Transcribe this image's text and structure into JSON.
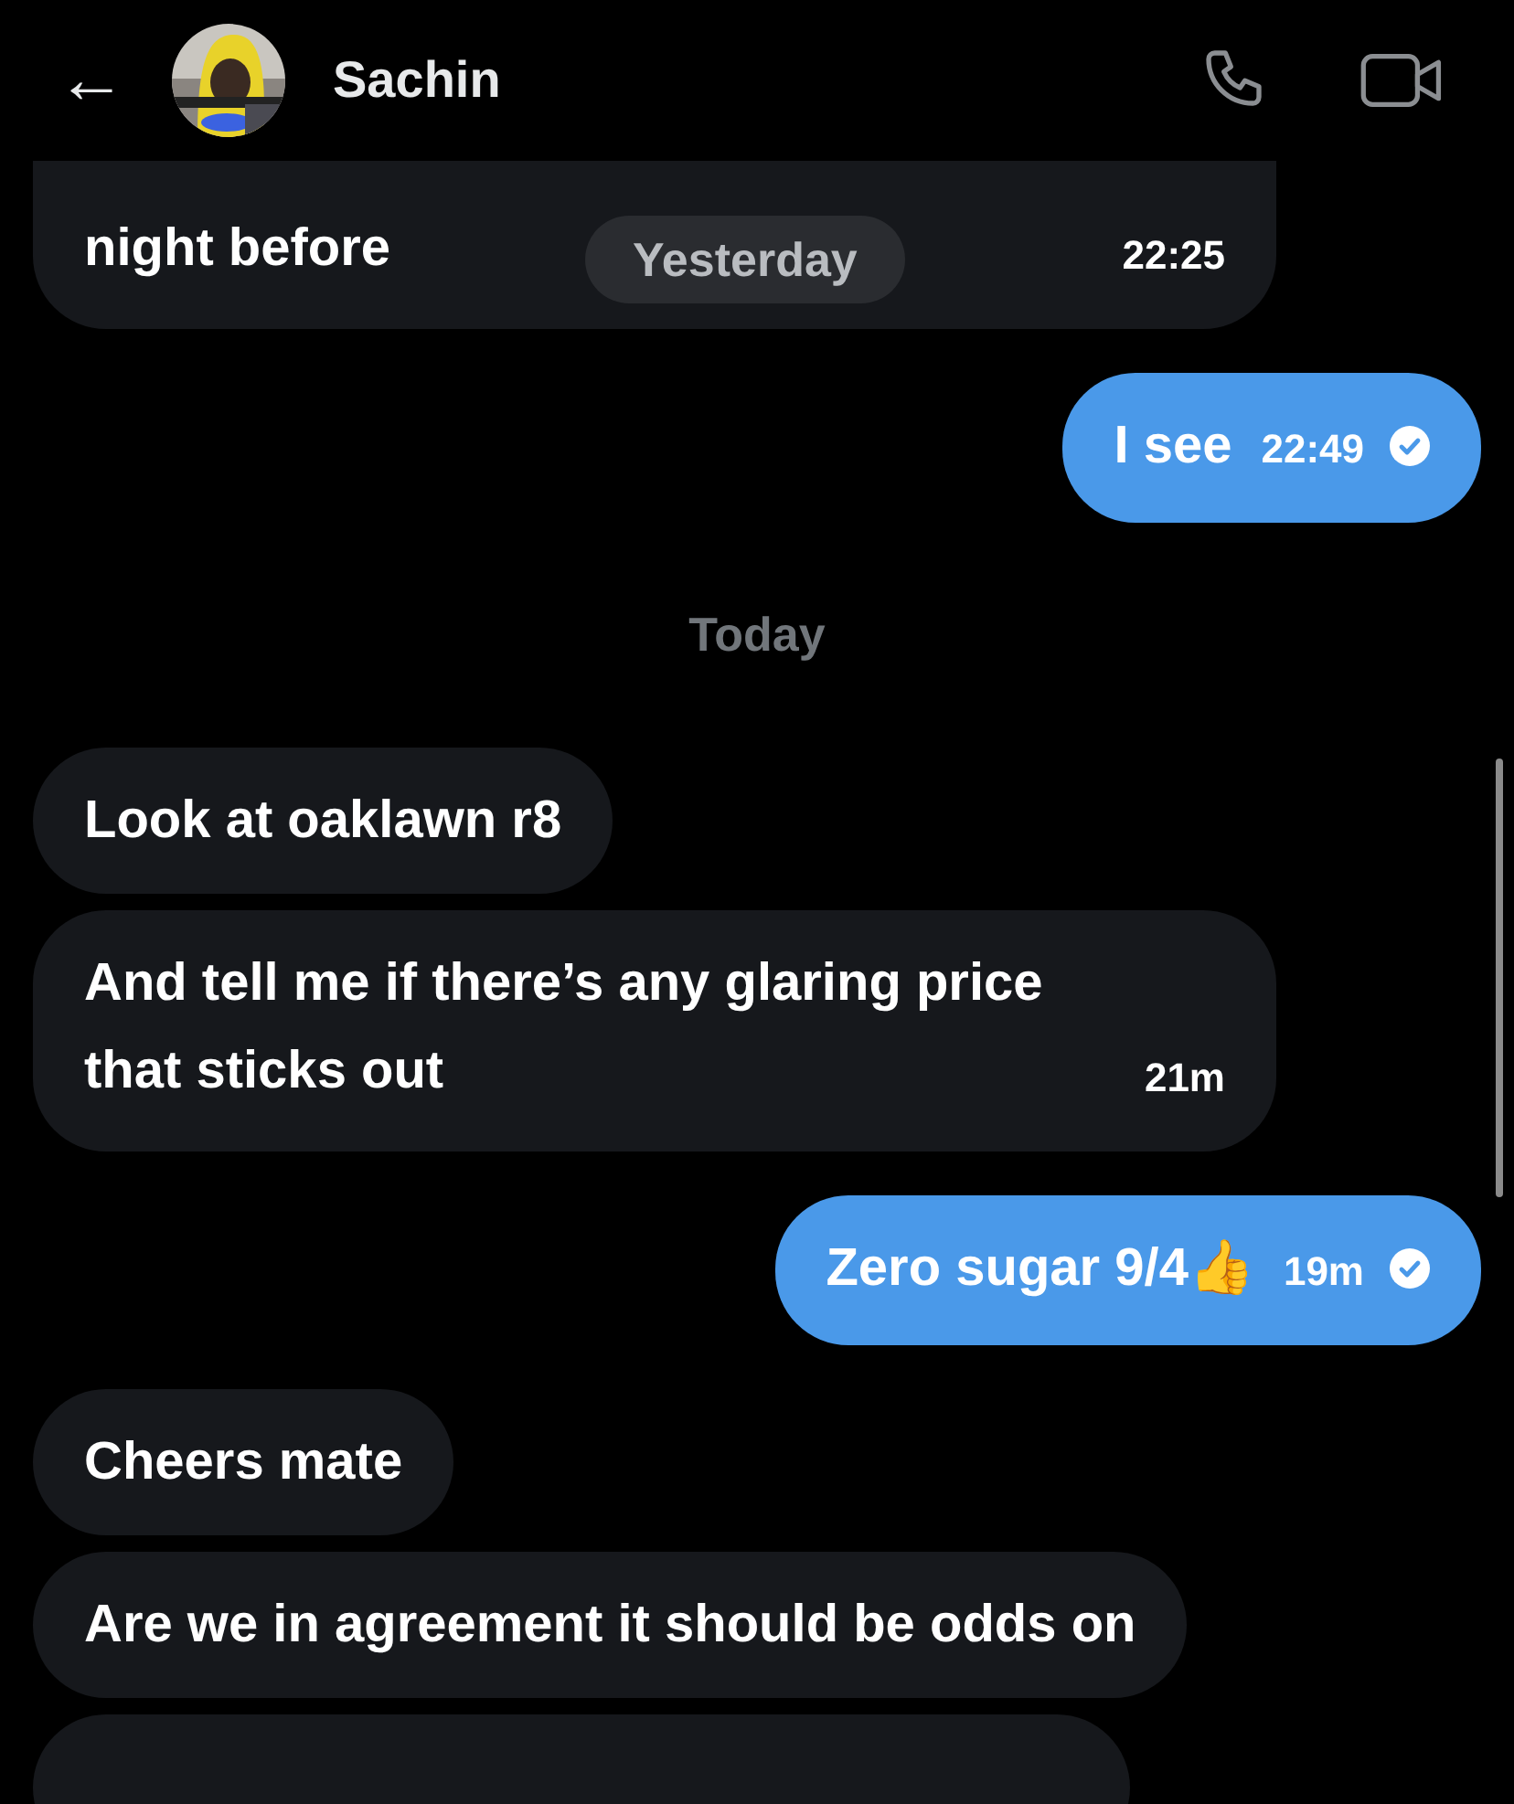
{
  "header": {
    "back": "←",
    "name": "Sachin"
  },
  "messages": [
    {
      "kind": "incoming",
      "text": "night before",
      "time": "22:25",
      "pill": "Yesterday"
    },
    {
      "kind": "outgoing",
      "text": "I see",
      "time": "22:49",
      "read": true
    },
    {
      "kind": "date",
      "text": "Today"
    },
    {
      "kind": "incoming",
      "text": "Look at oaklawn r8"
    },
    {
      "kind": "incoming",
      "text": "And tell me if there’s any glaring price that sticks out",
      "time": "21m"
    },
    {
      "kind": "outgoing",
      "text": "Zero sugar 9/4👍",
      "time": "19m",
      "read": true
    },
    {
      "kind": "incoming",
      "text": "Cheers mate"
    },
    {
      "kind": "incoming",
      "text": "Are we in agreement it should be odds on"
    },
    {
      "kind": "incoming"
    }
  ]
}
